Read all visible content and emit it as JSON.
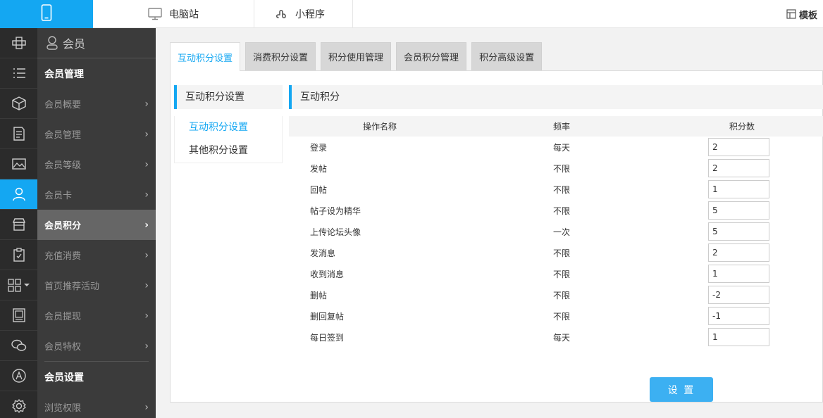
{
  "topbar": {
    "pc_label": "电脑站",
    "mini_label": "小程序",
    "template_label": "模板"
  },
  "sidebar": {
    "header": "会员",
    "groups": [
      {
        "label": "会员管理"
      },
      {
        "label": "会员设置"
      }
    ],
    "items": [
      {
        "label": "会员概要"
      },
      {
        "label": "会员管理"
      },
      {
        "label": "会员等级"
      },
      {
        "label": "会员卡"
      },
      {
        "label": "会员积分"
      },
      {
        "label": "充值消费"
      },
      {
        "label": "首页推荐活动"
      },
      {
        "label": "会员提现"
      },
      {
        "label": "会员特权"
      },
      {
        "label": "浏览权限"
      }
    ]
  },
  "tabs": [
    {
      "label": "互动积分设置"
    },
    {
      "label": "消费积分设置"
    },
    {
      "label": "积分使用管理"
    },
    {
      "label": "会员积分管理"
    },
    {
      "label": "积分高级设置"
    }
  ],
  "subnav": {
    "title": "互动积分设置",
    "items": [
      {
        "label": "互动积分设置"
      },
      {
        "label": "其他积分设置"
      }
    ]
  },
  "section": {
    "title": "互动积分",
    "columns": {
      "name": "操作名称",
      "freq": "频率",
      "points": "积分数"
    },
    "rows": [
      {
        "name": "登录",
        "freq": "每天",
        "points": "2"
      },
      {
        "name": "发帖",
        "freq": "不限",
        "points": "2"
      },
      {
        "name": "回帖",
        "freq": "不限",
        "points": "1"
      },
      {
        "name": "帖子设为精华",
        "freq": "不限",
        "points": "5"
      },
      {
        "name": "上传论坛头像",
        "freq": "一次",
        "points": "5"
      },
      {
        "name": "发消息",
        "freq": "不限",
        "points": "2"
      },
      {
        "name": "收到消息",
        "freq": "不限",
        "points": "1"
      },
      {
        "name": "删帖",
        "freq": "不限",
        "points": "-2"
      },
      {
        "name": "删回复帖",
        "freq": "不限",
        "points": "-1"
      },
      {
        "name": "每日签到",
        "freq": "每天",
        "points": "1"
      }
    ],
    "submit_label": "设 置"
  },
  "colors": {
    "accent": "#14a7f2",
    "button": "#3cb0f2",
    "sidebar": "#3b3b3b",
    "rail": "#2b2b2b"
  }
}
